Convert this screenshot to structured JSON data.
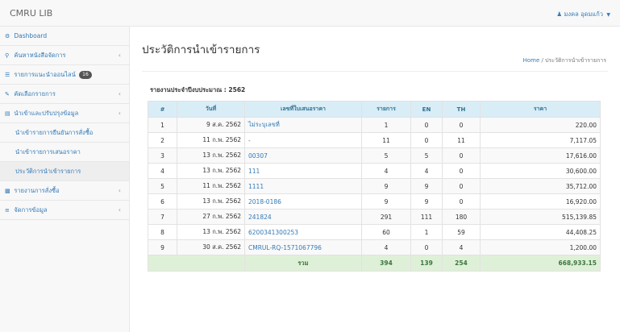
{
  "navbar": {
    "brand": "CMRU LIB",
    "user": "มงคล อุดมแก้ว"
  },
  "sidebar": {
    "dashboard": "Dashboard",
    "search": "ค้นหาหนังสือจัดการ",
    "online_list": "รายการแนะนำออนไลน์",
    "online_badge": "16",
    "select_items": "คัดเลือกรายการ",
    "import_menu": "นำเข้าและปรับปรุงข้อมูล",
    "sub_items": [
      "นำเข้ารายการยืนยันการสั่งซื้อ",
      "นำเข้ารายการเสนอราคา",
      "ประวัติการนำเข้ารายการ"
    ],
    "order_report": "รายงานการสั่งซื้อ",
    "manage_data": "จัดการข้อมูล"
  },
  "main": {
    "title": "ประวัติการนำเข้ารายการ",
    "breadcrumb_home": "Home",
    "breadcrumb_sep": "/",
    "breadcrumb_current": "ประวัติการนำเข้ารายการ",
    "report_label": "รายงานประจำปีงบประมาณ : 2562"
  },
  "table": {
    "headers": [
      "#",
      "วันที่",
      "เลขที่ใบเสนอราคา",
      "รายการ",
      "EN",
      "TH",
      "ราคา"
    ],
    "rows": [
      [
        "1",
        "9 ส.ค. 2562",
        "ไม่ระบุเลขที่",
        "1",
        "0",
        "0",
        "220.00"
      ],
      [
        "2",
        "11 ก.พ. 2562",
        "-",
        "11",
        "0",
        "11",
        "7,117.05"
      ],
      [
        "3",
        "13 ก.พ. 2562",
        "00307",
        "5",
        "5",
        "0",
        "17,616.00"
      ],
      [
        "4",
        "13 ก.พ. 2562",
        "111",
        "4",
        "4",
        "0",
        "30,600.00"
      ],
      [
        "5",
        "11 ก.พ. 2562",
        "1111",
        "9",
        "9",
        "0",
        "35,712.00"
      ],
      [
        "6",
        "13 ก.พ. 2562",
        "2018-0186",
        "9",
        "9",
        "0",
        "16,920.00"
      ],
      [
        "7",
        "27 ก.พ. 2562",
        "241824",
        "291",
        "111",
        "180",
        "515,139.85"
      ],
      [
        "8",
        "13 ก.พ. 2562",
        "6200341300253",
        "60",
        "1",
        "59",
        "44,408.25"
      ],
      [
        "9",
        "30 ส.ค. 2562",
        "CMRUL-RQ-1571067796",
        "4",
        "0",
        "4",
        "1,200.00"
      ]
    ],
    "footer": {
      "label": "รวม",
      "items": "394",
      "en": "139",
      "th": "254",
      "price": "668,933.15"
    }
  }
}
